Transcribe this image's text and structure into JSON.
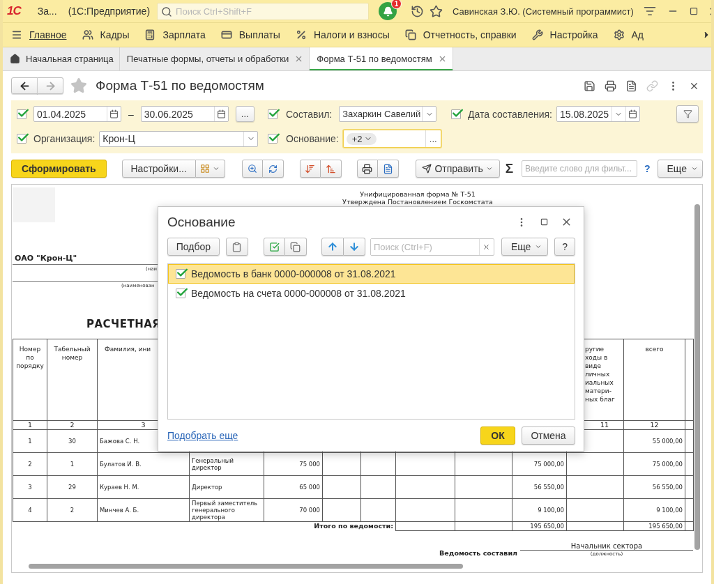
{
  "title_bar": {
    "logo": "1С",
    "app_name": "За...",
    "platform": "(1С:Предприятие)",
    "search": {
      "placeholder": "Поиск Ctrl+Shift+F"
    },
    "notifications_badge": "1",
    "user": "Савинская З.Ю. (Системный программист)"
  },
  "sections": [
    {
      "label": "Главное",
      "selected": true
    },
    {
      "label": "Кадры",
      "selected": false
    },
    {
      "label": "Зарплата",
      "selected": false
    },
    {
      "label": "Выплаты",
      "selected": false
    },
    {
      "label": "Налоги и взносы",
      "selected": false
    },
    {
      "label": "Отчетность, справки",
      "selected": false
    },
    {
      "label": "Настройка",
      "selected": false
    },
    {
      "label": "Ад",
      "selected": false
    }
  ],
  "open_tabs": [
    {
      "label": "Начальная страница",
      "selected": false,
      "closable": false
    },
    {
      "label": "Печатные формы, отчеты и обработки",
      "selected": false,
      "closable": true
    },
    {
      "label": "Форма Т-51 по ведомостям",
      "selected": true,
      "closable": true
    }
  ],
  "form": {
    "title": "Форма Т-51 по ведомостям",
    "filters": {
      "period": {
        "enabled": true,
        "from": "01.04.2025",
        "separator": "–",
        "to": "30.06.2025",
        "more": "..."
      },
      "compiled_by": {
        "enabled": true,
        "label": "Составил:",
        "value": "Захаркин Савелий"
      },
      "compile_date": {
        "enabled": true,
        "label": "Дата составления:",
        "value": "15.08.2025"
      },
      "organization": {
        "enabled": true,
        "label": "Организация:",
        "value": "Крон-Ц"
      },
      "basis": {
        "enabled": true,
        "label": "Основание:",
        "chip": "+2",
        "more": "..."
      }
    },
    "toolbar": {
      "generate": "Сформировать",
      "settings": "Настройки...",
      "send": "Отправить",
      "sum_sign": "Σ",
      "search": {
        "placeholder": "Введите слово для фильт..."
      },
      "help": "?",
      "more": "Еще"
    },
    "report": {
      "form_code": "Унифицированная форма № Т-51",
      "approved": "Утверждена Постановлением Госкомстата",
      "organization": "ОАО \"Крон-Ц\"",
      "org_caption": "(наи",
      "division_caption": "(наименован",
      "doc_title": "РАСЧЕТНАЯ",
      "header": {
        "column_1": "Номер по порядку",
        "column_2": "Табельный номер",
        "column_3": "Фамилия, ини",
        "column_11": "ругие\nходы в\nвиде\nличных\nиальных\nматери-\nных благ",
        "column_12": "всего"
      },
      "numbers": {
        "column_1": "1",
        "column_2": "2",
        "column_3": "3",
        "column_11": "11",
        "column_12": "12"
      },
      "rows": [
        {
          "column_1": "1",
          "column_2": "30",
          "column_3": "Бажова С. Н.",
          "column_12": "55 000,00"
        },
        {
          "column_1": "2",
          "column_2": "1",
          "column_3": "Булатов И. В.",
          "column_4": "Генеральный директор",
          "column_5": "75 000",
          "column_10": "75 000,00",
          "column_12": "75 000,00"
        },
        {
          "column_1": "3",
          "column_2": "29",
          "column_3": "Кураев Н. М.",
          "column_4": "Директор",
          "column_5": "65 000",
          "column_10": "56 550,00",
          "column_12": "56 550,00"
        },
        {
          "column_1": "4",
          "column_2": "2",
          "column_3": "Минчев А. Б.",
          "column_4": "Первый заместитель генерального директора",
          "column_5": "70 000",
          "column_10": "9 100,00",
          "column_12": "9 100,00"
        }
      ],
      "total": {
        "label": "Итого по ведомости:",
        "column_10": "195 650,00",
        "column_12": "195 650,00"
      },
      "signature": {
        "label": "Ведомость составил",
        "position": "Начальник сектора",
        "caption": "(должность)"
      }
    }
  },
  "dialog": {
    "title": "Основание",
    "pick": "Подбор",
    "search": {
      "placeholder": "Поиск (Ctrl+F)"
    },
    "more": "Еще",
    "help": "?",
    "items": [
      {
        "text": "Ведомость в банк 0000-000008 от 31.08.2021",
        "checked": true,
        "selected": true
      },
      {
        "text": "Ведомость на счета 0000-000008 от 31.08.2021",
        "checked": true,
        "selected": false
      }
    ],
    "pick_more": "Подобрать еще",
    "ok": "ОК",
    "cancel": "Отмена"
  }
}
